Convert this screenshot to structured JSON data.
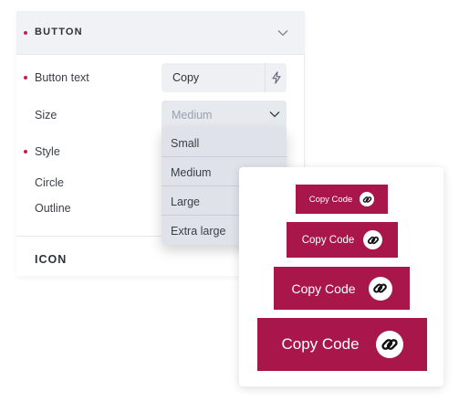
{
  "panel": {
    "section_title": "BUTTON",
    "button_text": {
      "label": "Button text",
      "value": "Copy"
    },
    "size": {
      "label": "Size",
      "selected": "Medium",
      "options": [
        "Small",
        "Medium",
        "Large",
        "Extra large"
      ]
    },
    "style": {
      "label": "Style"
    },
    "circle": {
      "label": "Circle"
    },
    "outline": {
      "label": "Outline"
    },
    "icon_section_title": "ICON"
  },
  "preview": {
    "buttons": [
      {
        "label": "Copy Code",
        "size": "small"
      },
      {
        "label": "Copy Code",
        "size": "medium"
      },
      {
        "label": "Copy Code",
        "size": "large"
      },
      {
        "label": "Copy Code",
        "size": "extra-large"
      }
    ]
  },
  "colors": {
    "accent": "#a8164a",
    "required_dot": "#c01f58",
    "section_bg": "#f1f2f5",
    "field_bg": "#eef0f4",
    "dropdown_bg": "#dfe3e9"
  },
  "icons": {
    "collapse": "chevron-down-icon",
    "dynamic": "lightning-icon",
    "select": "chevron-down-icon",
    "link": "link-icon"
  }
}
